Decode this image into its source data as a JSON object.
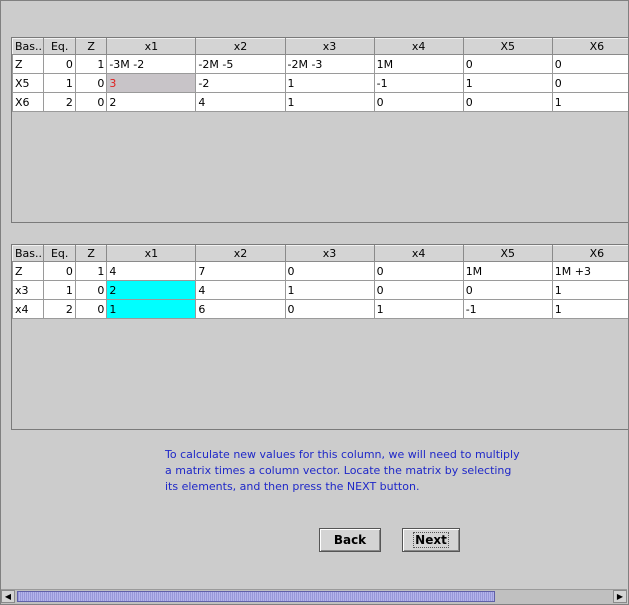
{
  "tables": {
    "headers": [
      "Bas...",
      "Eq.",
      "Z",
      "x1",
      "x2",
      "x3",
      "x4",
      "X5",
      "X6"
    ],
    "top": [
      [
        "Z",
        "0",
        "1",
        "-3M -2",
        "-2M -5",
        "-2M -3",
        "1M",
        "0",
        "0"
      ],
      [
        "X5",
        "1",
        "0",
        "3",
        "-2",
        "1",
        "-1",
        "1",
        "0"
      ],
      [
        "X6",
        "2",
        "0",
        "2",
        "4",
        "1",
        "0",
        "0",
        "1"
      ]
    ],
    "bottom": [
      [
        "Z",
        "0",
        "1",
        "4",
        "7",
        "0",
        "0",
        "1M",
        "1M +3"
      ],
      [
        "x3",
        "1",
        "0",
        "2",
        "4",
        "1",
        "0",
        "0",
        "1"
      ],
      [
        "x4",
        "2",
        "0",
        "1",
        "6",
        "0",
        "1",
        "-1",
        "1"
      ]
    ]
  },
  "instruction": [
    "To calculate new values for this column, we will need to multiply",
    "a matrix times a column vector. Locate the matrix by selecting",
    "its elements, and then press the NEXT button."
  ],
  "buttons": {
    "back": "Back",
    "next": "Next"
  },
  "scrollbar": {
    "left_icon": "arrow-left-icon",
    "right_icon": "arrow-right-icon"
  },
  "colors": {
    "selected_gray": "#c8c4c8",
    "selected_cyan": "#00ffff",
    "instruction_text": "#1f28c8",
    "highlight_value": "#e02020"
  }
}
